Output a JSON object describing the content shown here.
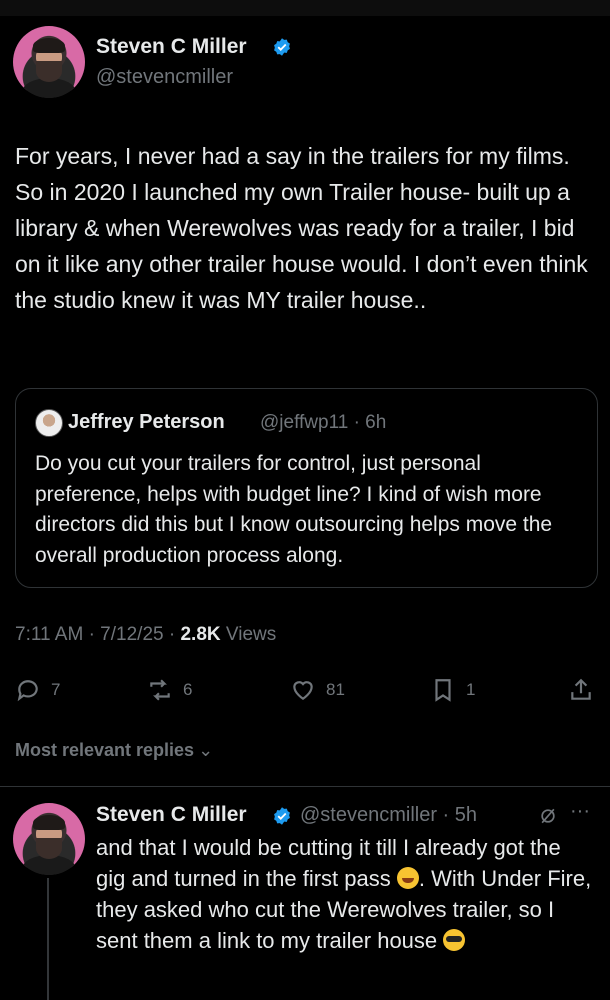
{
  "tweet": {
    "author_name": "Steven C Miller",
    "author_handle": "@stevencmiller",
    "text": "For years, I never had a say in the trailers for my films. So in 2020 I launched my own Trailer house- built up a library & when Werewolves was ready for a trailer, I bid on it like any other trailer house would. I don’t even think the studio knew it was MY trailer house..",
    "time": "7:11 AM · 7/12/25 · ",
    "views_count": "2.8K",
    "views_label": " Views",
    "replies": "7",
    "reposts": "6",
    "likes": "81",
    "bookmarks": "1"
  },
  "quote": {
    "author_name": "Jeffrey Peterson",
    "meta": "@jeffwp11 · 6h",
    "text": "Do you cut your trailers for control, just personal preference, helps with budget line? I kind of wish more directors did this but I know outsourcing helps move the overall production process along."
  },
  "replies_sort": {
    "label": "Most relevant replies"
  },
  "reply": {
    "author_name": "Steven C Miller",
    "meta": "@stevencmiller · 5h",
    "text_part1": "and that I would be cutting it till I already got the gig and turned in the first pass ",
    "text_part2": ". With Under Fire, they asked who cut the Werewolves trailer, so I sent them a link to my trailer house "
  },
  "colors": {
    "background": "#000000",
    "text": "#e7e9ea",
    "secondary": "#71767b",
    "verified": "#1d9bf0",
    "border": "#2f3336"
  }
}
